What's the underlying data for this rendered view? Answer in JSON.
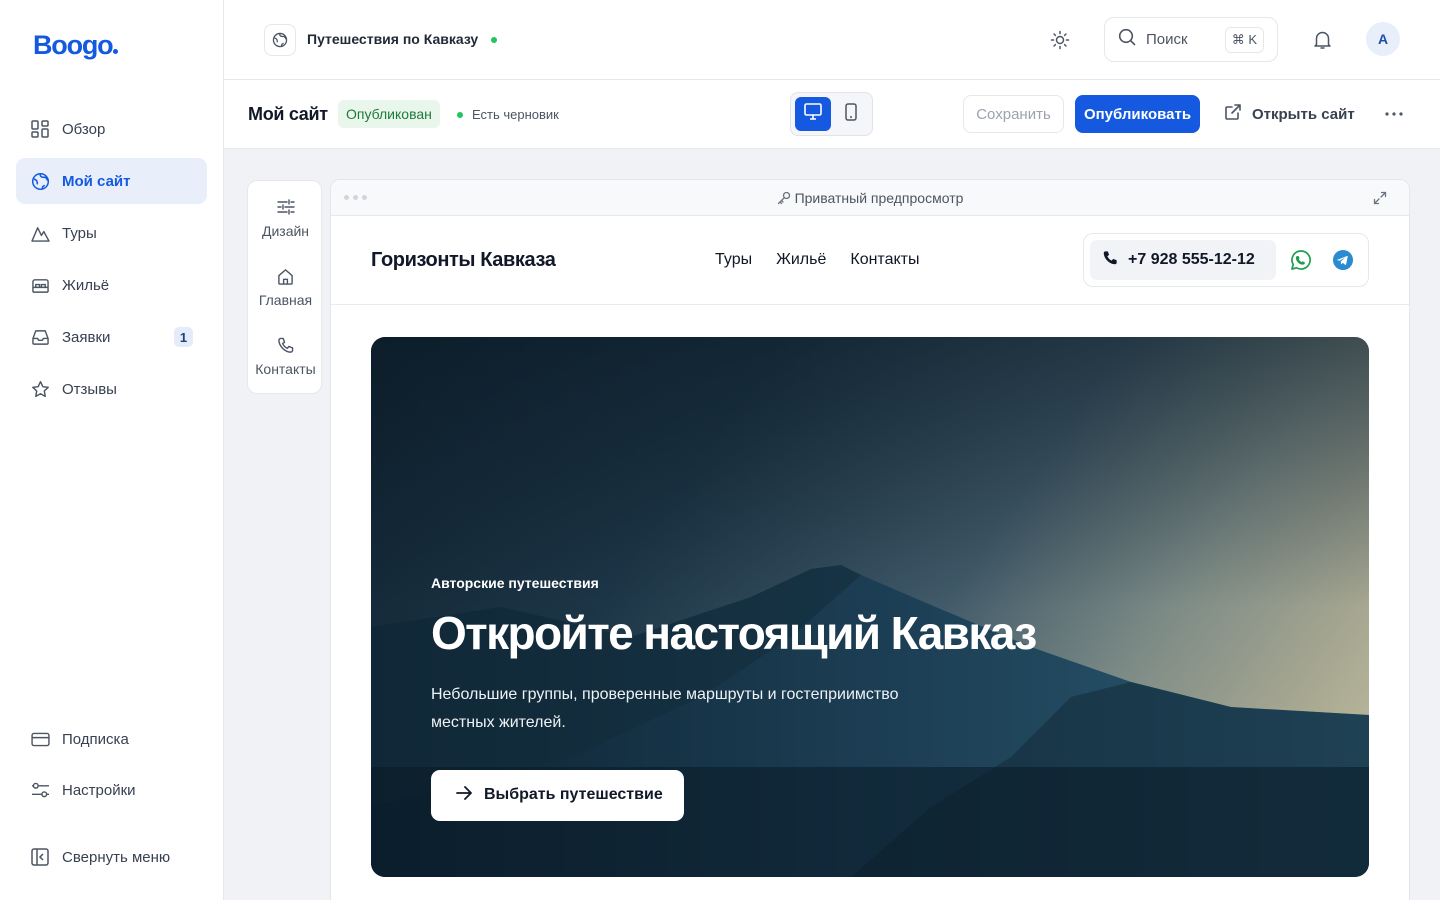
{
  "brand": {
    "logo": "Boogo",
    "color": "#1459e0"
  },
  "sidebar": {
    "items": [
      {
        "label": "Обзор",
        "icon": "grid-icon"
      },
      {
        "label": "Мой сайт",
        "icon": "globe-icon",
        "active": true
      },
      {
        "label": "Туры",
        "icon": "mountain-icon"
      },
      {
        "label": "Жильё",
        "icon": "bed-icon"
      },
      {
        "label": "Заявки",
        "icon": "inbox-icon",
        "badge": "1"
      },
      {
        "label": "Отзывы",
        "icon": "star-icon"
      }
    ],
    "bottom": [
      {
        "label": "Подписка",
        "icon": "card-icon"
      },
      {
        "label": "Настройки",
        "icon": "sliders-icon"
      },
      {
        "label": "Свернуть меню",
        "icon": "collapse-icon"
      }
    ]
  },
  "topbar": {
    "project": "Путешествия по Кавказу",
    "search_placeholder": "Поиск",
    "shortcut": "⌘ K",
    "avatar": "A"
  },
  "subbar": {
    "title": "Мой сайт",
    "status": "Опубликован",
    "draft": "Есть черновик",
    "save": "Сохранить",
    "publish": "Опубликовать",
    "open_site": "Открыть сайт"
  },
  "sections": [
    {
      "label": "Дизайн",
      "icon": "adjustments-icon"
    },
    {
      "label": "Главная",
      "icon": "home-icon"
    },
    {
      "label": "Контакты",
      "icon": "phone-icon"
    }
  ],
  "preview": {
    "label": "Приватный предпросмотр",
    "site_brand": "Горизонты Кавказа",
    "nav": [
      "Туры",
      "Жильё",
      "Контакты"
    ],
    "phone": "+7 928 555-12-12",
    "hero": {
      "kicker": "Авторские путешествия",
      "title": "Откройте настоящий Кавказ",
      "subtitle": "Небольшие группы, проверенные маршруты и гостеприимство местных жителей.",
      "cta": "Выбрать путешествие"
    }
  }
}
